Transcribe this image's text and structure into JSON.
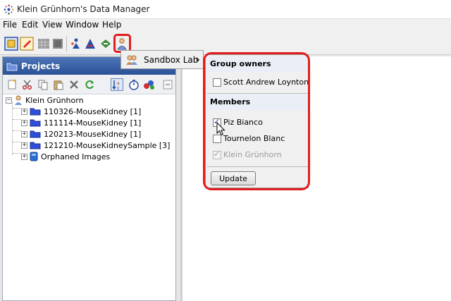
{
  "window": {
    "title": "Klein Grünhorn's Data Manager"
  },
  "menu": [
    "File",
    "Edit",
    "View",
    "Window",
    "Help"
  ],
  "projects_panel": {
    "title": "Projects",
    "tree": {
      "root": "Klein Grünhorn",
      "children": [
        "110326-MouseKidney [1]",
        "111114-MouseKidney [1]",
        "120213-MouseKidney [1]",
        "121210-MouseKidneySample [3]",
        "Orphaned Images"
      ]
    }
  },
  "group_menu": {
    "selected_group": "Sandbox Lab"
  },
  "popup": {
    "owners_header": "Group owners",
    "owners": [
      {
        "name": "Scott Andrew Loynton",
        "checked": false
      }
    ],
    "members_header": "Members",
    "members": [
      {
        "name": "Piz Bianco",
        "checked": true
      },
      {
        "name": "Tournelon Blanc",
        "checked": false
      },
      {
        "name": "Klein Grünhorn",
        "checked": true,
        "disabled": true
      }
    ],
    "update_label": "Update"
  },
  "colors": {
    "highlight": "#e31d1d",
    "panel_header": "#2c5296"
  }
}
